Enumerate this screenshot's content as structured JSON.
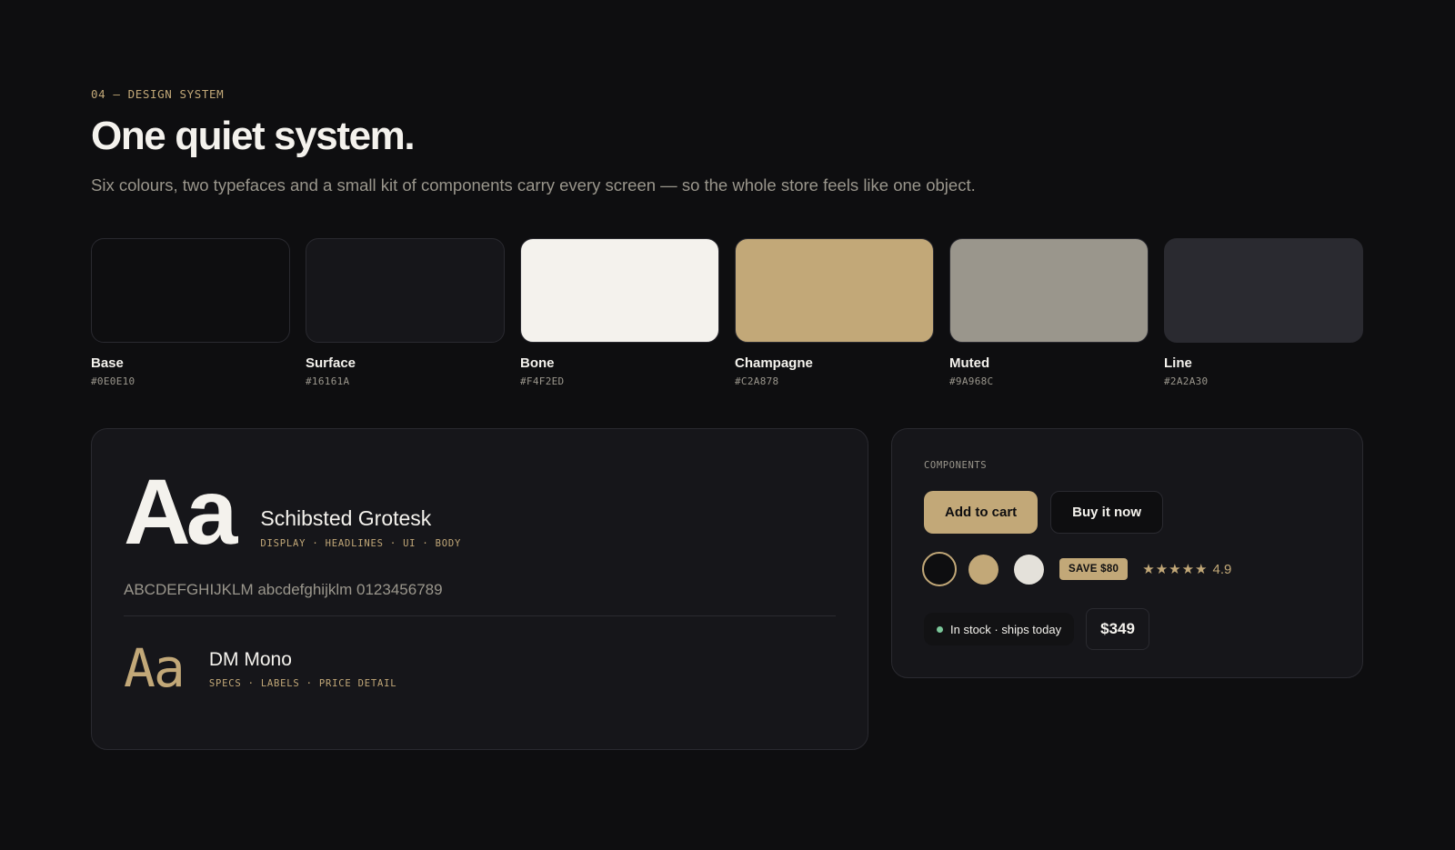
{
  "header": {
    "eyebrow": "04 — DESIGN SYSTEM",
    "title": "One quiet system.",
    "subtitle": "Six colours, two typefaces and a small kit of components carry every screen — so the whole store feels like one object."
  },
  "palette": [
    {
      "name": "Base",
      "hex": "#0E0E10",
      "color": "#0E0E10"
    },
    {
      "name": "Surface",
      "hex": "#16161A",
      "color": "#16161A"
    },
    {
      "name": "Bone",
      "hex": "#F4F2ED",
      "color": "#F4F2ED"
    },
    {
      "name": "Champagne",
      "hex": "#C2A878",
      "color": "#C2A878"
    },
    {
      "name": "Muted",
      "hex": "#9A968C",
      "color": "#9A968C"
    },
    {
      "name": "Line",
      "hex": "#2A2A30",
      "color": "#2A2A30"
    }
  ],
  "typography": {
    "display": {
      "sample": "Aa",
      "name": "Schibsted Grotesk",
      "uses": "DISPLAY · HEADLINES · UI · BODY",
      "glyphs": "ABCDEFGHIJKLM abcdefghijklm 0123456789"
    },
    "mono": {
      "sample": "Aa",
      "name": "DM Mono",
      "uses": "SPECS · LABELS · PRICE DETAIL"
    }
  },
  "components": {
    "label": "COMPONENTS",
    "add_to_cart": "Add to cart",
    "buy_now": "Buy it now",
    "swatch_options": [
      {
        "name": "selected-ring",
        "color": "#0E0E10"
      },
      {
        "name": "champagne",
        "color": "#C2A878"
      },
      {
        "name": "bone",
        "color": "#E4E1DA"
      }
    ],
    "badge": "SAVE $80",
    "stars": "★★★★★",
    "rating": "4.9",
    "stock": "In stock · ships today",
    "stock_color": "#7BC79A",
    "price": "$349"
  }
}
